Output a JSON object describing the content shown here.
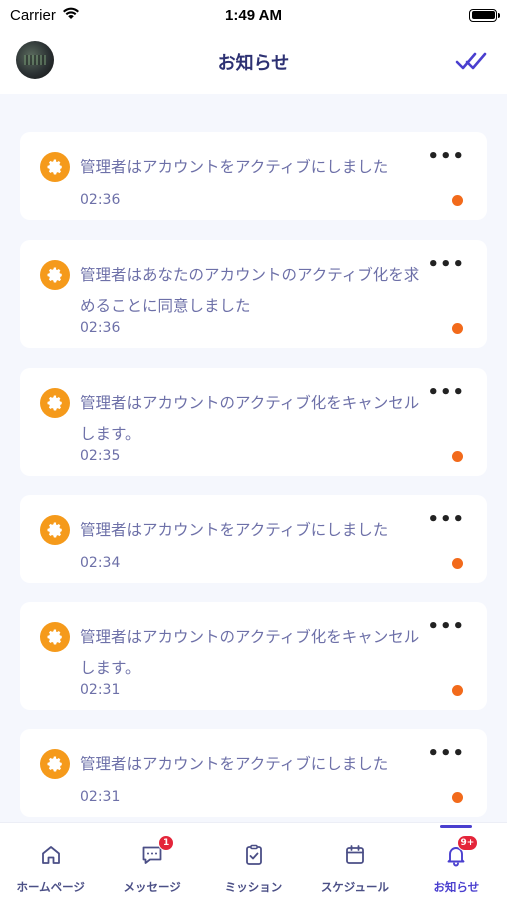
{
  "status_bar": {
    "carrier": "Carrier",
    "time": "1:49 AM"
  },
  "header": {
    "title": "お知らせ"
  },
  "notifications": [
    {
      "text": "管理者はアカウントをアクティブにしました",
      "time": "02:36",
      "unread": true
    },
    {
      "text": "管理者はあなたのアカウントのアクティブ化を求めることに同意しました",
      "time": "02:36",
      "unread": true
    },
    {
      "text": "管理者はアカウントのアクティブ化をキャンセルします。",
      "time": "02:35",
      "unread": true
    },
    {
      "text": "管理者はアカウントをアクティブにしました",
      "time": "02:34",
      "unread": true
    },
    {
      "text": "管理者はアカウントのアクティブ化をキャンセルします。",
      "time": "02:31",
      "unread": true
    },
    {
      "text": "管理者はアカウントをアクティブにしました",
      "time": "02:31",
      "unread": true
    }
  ],
  "more_label": "•••",
  "tabs": [
    {
      "label": "ホームページ",
      "icon": "home-icon",
      "badge": ""
    },
    {
      "label": "メッセージ",
      "icon": "message-icon",
      "badge": "1"
    },
    {
      "label": "ミッション",
      "icon": "mission-icon",
      "badge": ""
    },
    {
      "label": "スケジュール",
      "icon": "calendar-icon",
      "badge": ""
    },
    {
      "label": "お知らせ",
      "icon": "bell-icon",
      "badge": "9+",
      "active": true
    }
  ],
  "colors": {
    "accent": "#4a3fcf",
    "icon_orange": "#f59a1b",
    "unread_dot": "#f26a1b",
    "text": "#6d70a8",
    "title": "#2d3173"
  }
}
